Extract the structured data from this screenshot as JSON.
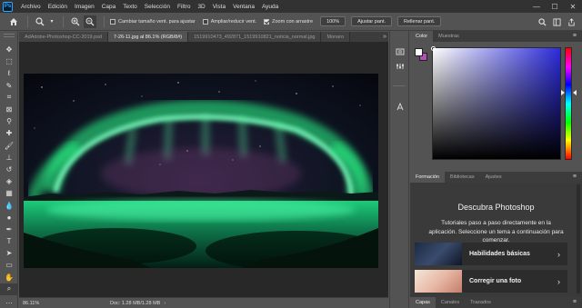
{
  "app": {
    "logo": "Ps"
  },
  "menu": [
    "Archivo",
    "Edición",
    "Imagen",
    "Capa",
    "Texto",
    "Selección",
    "Filtro",
    "3D",
    "Vista",
    "Ventana",
    "Ayuda"
  ],
  "window_controls": {
    "minimize": "—",
    "maximize": "☐",
    "close": "✕"
  },
  "options": {
    "checkbox_resize": "Cambiar tamaño vent. para ajustar",
    "checkbox_resize_checked": false,
    "checkbox_zoom_all": "Ampliar/reducir vent.",
    "checkbox_zoom_all_checked": false,
    "checkbox_scrubby": "Zoom con arrastre",
    "checkbox_scrubby_checked": true,
    "zoom_value": "100%",
    "fit_button": "Ajustar pant.",
    "fill_button": "Rellenar pant."
  },
  "tabs": [
    {
      "label": "AdAdobe-Photoshop-CC-2019.psd",
      "active": false
    },
    {
      "label": "7-26-11.jpg al 86.1% (RGB/8#)",
      "active": true
    },
    {
      "label": "1519910473_492871_1519910821_noticia_normal.jpg",
      "active": false
    },
    {
      "label": "Monaro",
      "active": false
    }
  ],
  "status": {
    "zoom": "86.11%",
    "doc": "Doc: 1.28 MB/1.28 MB",
    "arrow": "›"
  },
  "color_panel": {
    "tabs": [
      "Color",
      "Muestras"
    ],
    "foreground": "#ffffff",
    "background": "#b44db4",
    "hue_color": "#2b2bdc"
  },
  "learn_panel": {
    "tabs": [
      "Formación",
      "Bibliotecas",
      "Ajustes"
    ],
    "title": "Descubra Photoshop",
    "description": "Tutoriales paso a paso directamente en la aplicación. Seleccione un tema a continuación para comenzar.",
    "cards": [
      {
        "label": "Habilidades básicas"
      },
      {
        "label": "Corregir una foto"
      }
    ]
  },
  "layers_tabs": [
    "Capas",
    "Canales",
    "Trazados"
  ],
  "menu_icon": "≡"
}
